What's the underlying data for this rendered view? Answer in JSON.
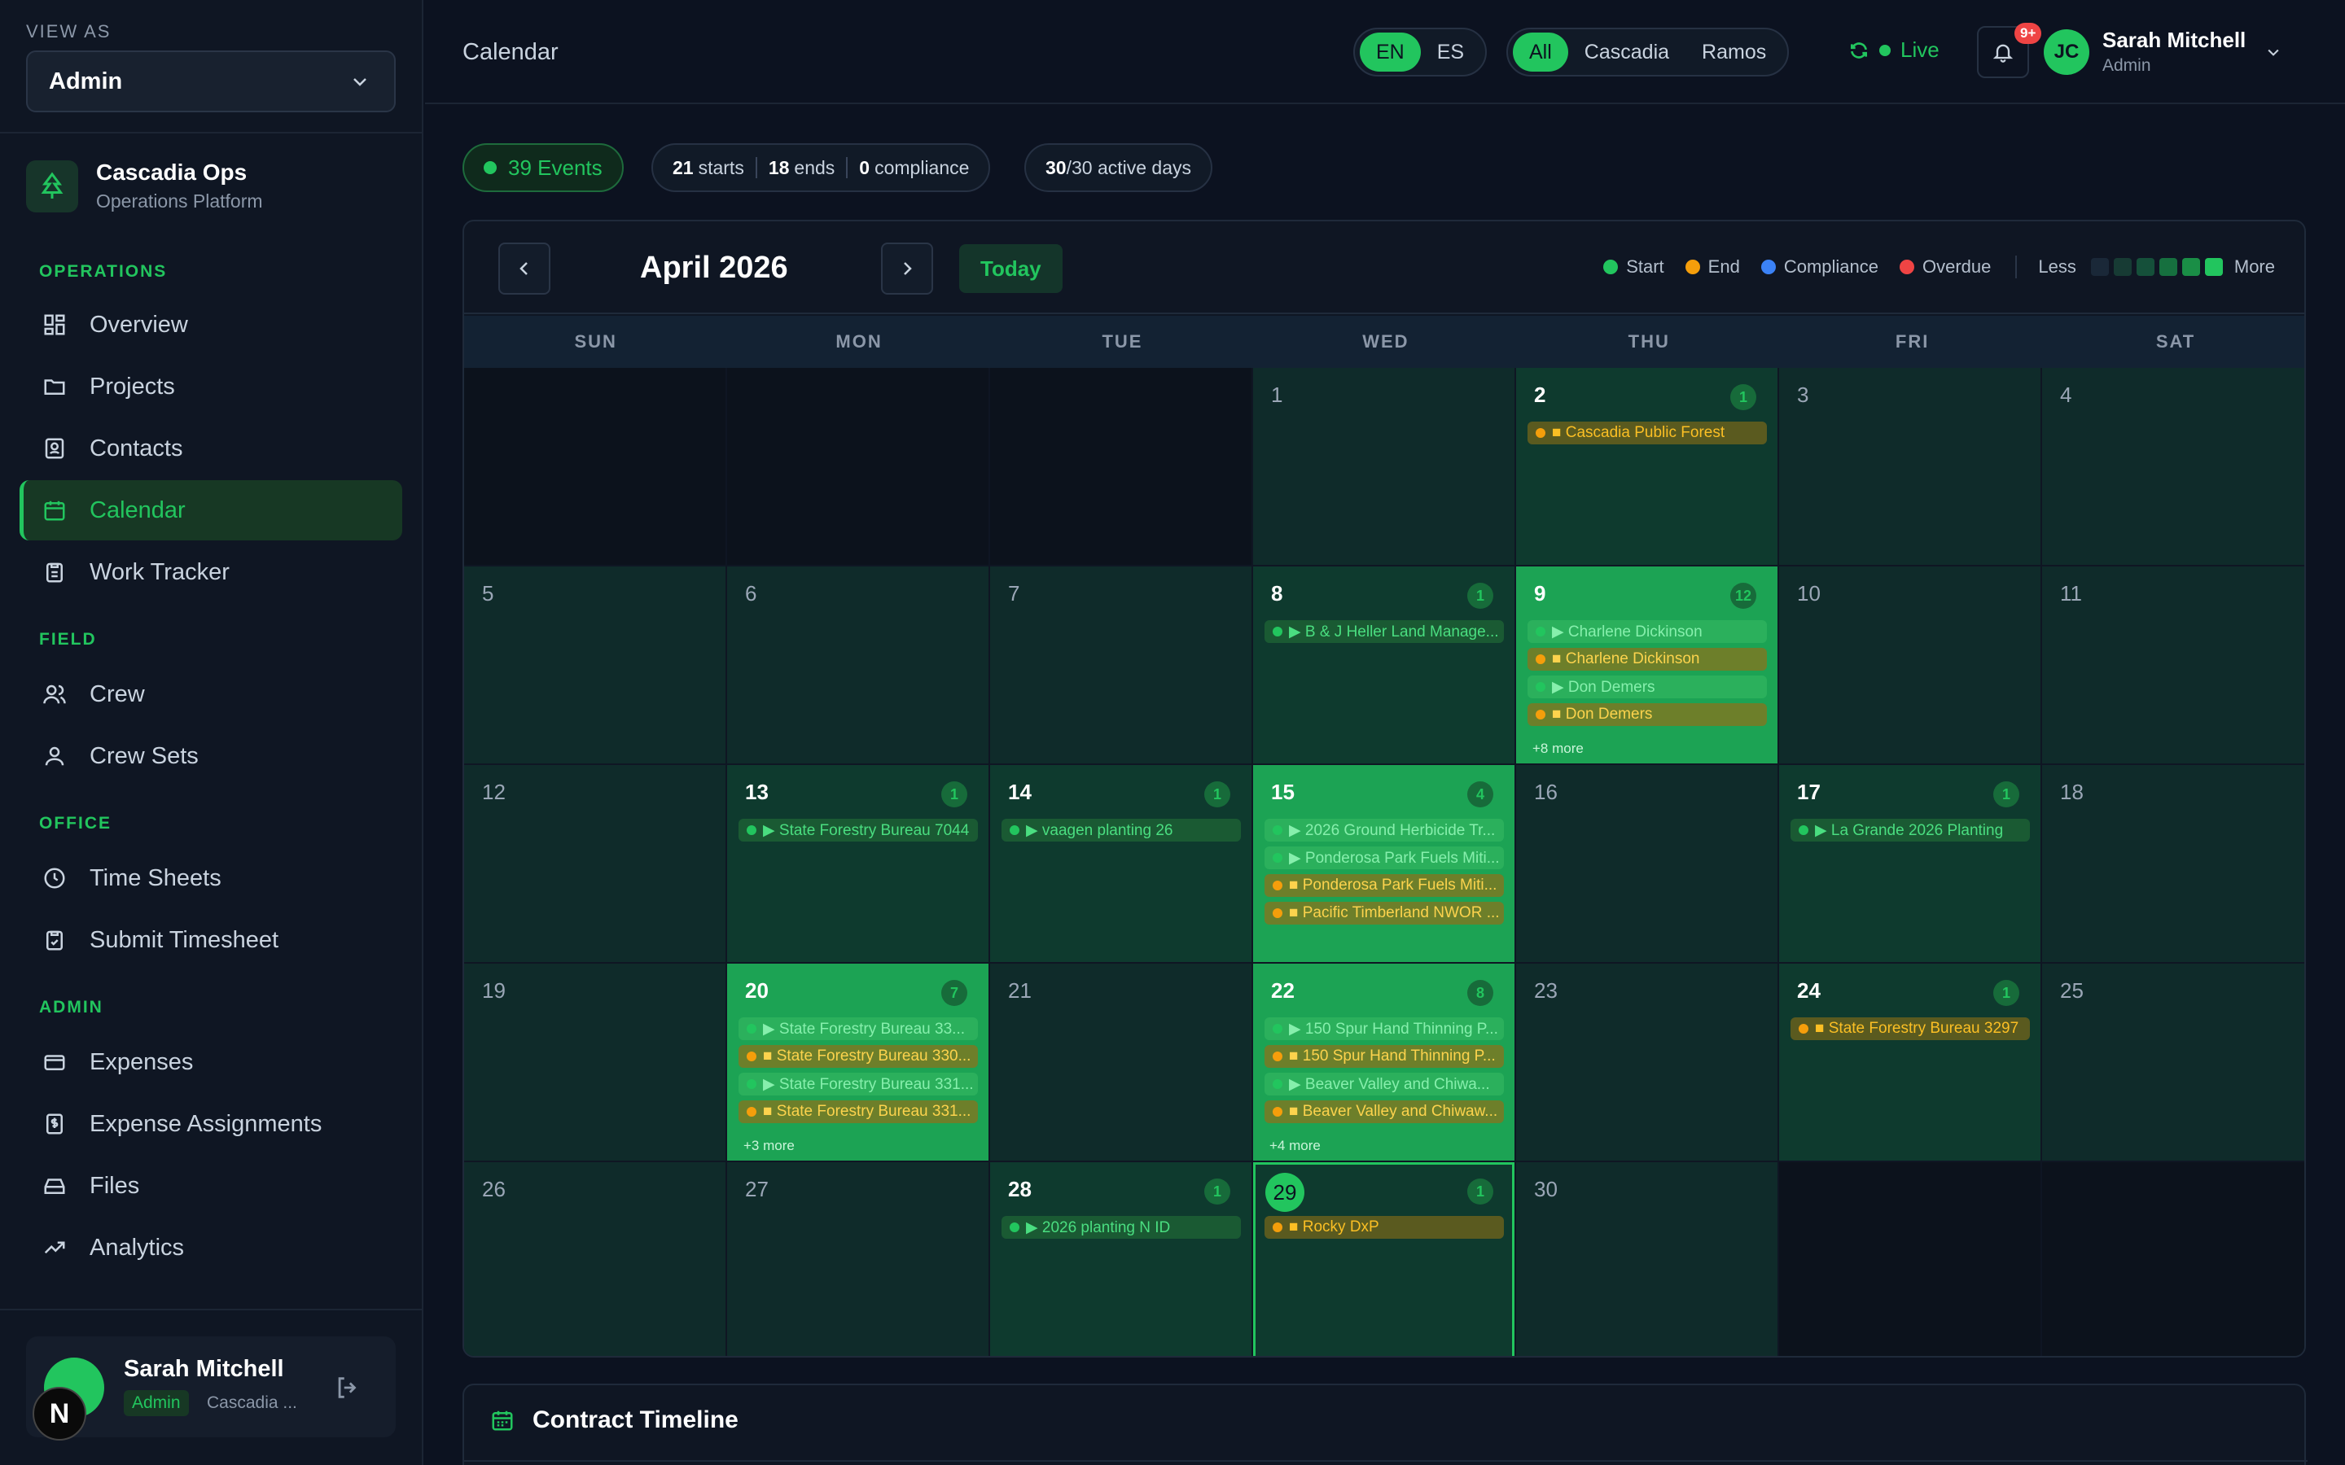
{
  "sidebar": {
    "view_as_label": "VIEW AS",
    "view_as_value": "Admin",
    "brand": {
      "title": "Cascadia Ops",
      "subtitle": "Operations Platform"
    },
    "sections": {
      "operations": "OPERATIONS",
      "field": "FIELD",
      "office": "OFFICE",
      "admin": "ADMIN"
    },
    "items": {
      "overview": "Overview",
      "projects": "Projects",
      "contacts": "Contacts",
      "calendar": "Calendar",
      "work_tracker": "Work Tracker",
      "crew": "Crew",
      "crew_sets": "Crew Sets",
      "time_sheets": "Time Sheets",
      "submit_timesheet": "Submit Timesheet",
      "expenses": "Expenses",
      "expense_assignments": "Expense Assignments",
      "files": "Files",
      "analytics": "Analytics"
    },
    "user": {
      "name": "Sarah Mitchell",
      "role": "Admin",
      "org": "Cascadia ...",
      "badge_letter": "N"
    }
  },
  "header": {
    "title": "Calendar",
    "languages": [
      "EN",
      "ES"
    ],
    "active_language": "EN",
    "filters": [
      "All",
      "Cascadia",
      "Ramos"
    ],
    "active_filter": "All",
    "live_label": "Live",
    "notification_count": "9+",
    "user": {
      "initials": "JC",
      "name": "Sarah Mitchell",
      "role": "Admin"
    }
  },
  "stats": {
    "events": "39 Events",
    "starts_num": "21",
    "starts_label": "starts",
    "ends_num": "18",
    "ends_label": "ends",
    "compliance_num": "0",
    "compliance_label": "compliance",
    "active_num": "30",
    "active_label": "/30 active days"
  },
  "calendar": {
    "month_label": "April 2026",
    "today_label": "Today",
    "legend": {
      "start": "Start",
      "end": "End",
      "compliance": "Compliance",
      "overdue": "Overdue",
      "less": "Less",
      "more": "More"
    },
    "colors": {
      "start": "#22c55e",
      "end": "#f59e0b",
      "compliance": "#3b82f6",
      "overdue": "#ef4444"
    },
    "weekdays": [
      "SUN",
      "MON",
      "TUE",
      "WED",
      "THU",
      "FRI",
      "SAT"
    ],
    "days": {
      "d1": "1",
      "d2": "2",
      "d3": "3",
      "d4": "4",
      "d5": "5",
      "d6": "6",
      "d7": "7",
      "d8": "8",
      "d9": "9",
      "d10": "10",
      "d11": "11",
      "d12": "12",
      "d13": "13",
      "d14": "14",
      "d15": "15",
      "d16": "16",
      "d17": "17",
      "d18": "18",
      "d19": "19",
      "d20": "20",
      "d21": "21",
      "d22": "22",
      "d23": "23",
      "d24": "24",
      "d25": "25",
      "d26": "26",
      "d27": "27",
      "d28": "28",
      "d29": "29",
      "d30": "30"
    },
    "counts": {
      "d2": "1",
      "d8": "1",
      "d9": "12",
      "d13": "1",
      "d14": "1",
      "d15": "4",
      "d17": "1",
      "d20": "7",
      "d22": "8",
      "d24": "1",
      "d28": "1",
      "d29": "1"
    },
    "events": {
      "d2": [
        "■ Cascadia Public Forest"
      ],
      "d8": [
        "▶ B & J Heller Land Manage..."
      ],
      "d9": [
        "▶ Charlene Dickinson",
        "■ Charlene Dickinson",
        "▶ Don Demers",
        "■ Don Demers"
      ],
      "d13": [
        "▶ State Forestry Bureau 7044"
      ],
      "d14": [
        "▶ vaagen planting 26"
      ],
      "d15": [
        "▶ 2026 Ground Herbicide Tr...",
        "▶ Ponderosa Park Fuels Miti...",
        "■ Ponderosa Park Fuels Miti...",
        "■ Pacific Timberland NWOR ..."
      ],
      "d17": [
        "▶ La Grande 2026 Planting"
      ],
      "d20": [
        "▶ State Forestry Bureau 33...",
        "■ State Forestry Bureau 330...",
        "▶ State Forestry Bureau 331...",
        "■ State Forestry Bureau 331..."
      ],
      "d22": [
        "▶ 150 Spur Hand Thinning P...",
        "■ 150 Spur Hand Thinning P...",
        "▶ Beaver Valley and Chiwa...",
        "■ Beaver Valley and Chiwaw..."
      ],
      "d24": [
        "■ State Forestry Bureau 3297"
      ],
      "d28": [
        "▶ 2026 planting N ID"
      ],
      "d29": [
        "■ Rocky DxP"
      ]
    },
    "more": {
      "d9": "+8 more",
      "d20": "+3 more",
      "d22": "+4 more"
    }
  },
  "timeline": {
    "title": "Contract Timeline"
  }
}
